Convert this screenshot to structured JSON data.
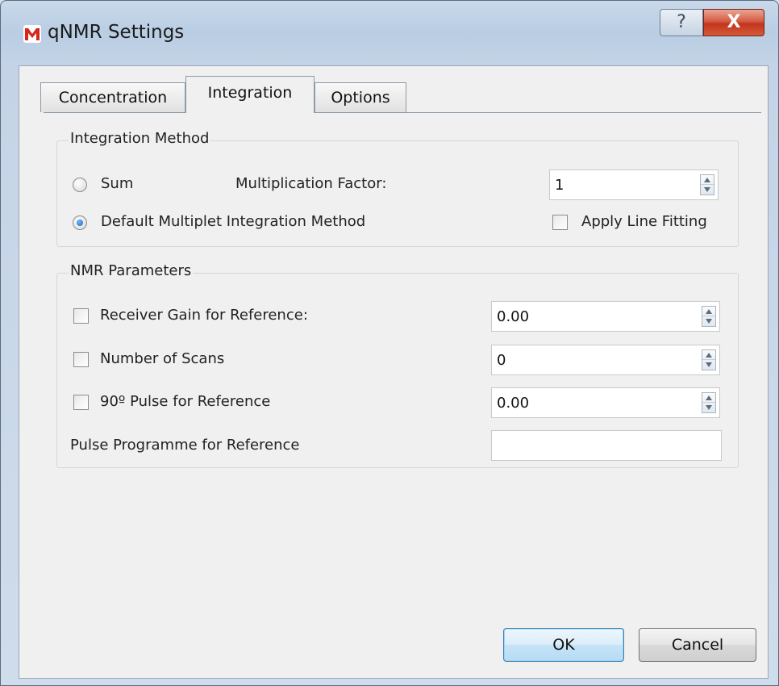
{
  "window": {
    "title": "qNMR Settings",
    "help_label": "?",
    "close_label": "X"
  },
  "tabs": [
    {
      "label": "Concentration",
      "active": false
    },
    {
      "label": "Integration",
      "active": true
    },
    {
      "label": "Options",
      "active": false
    }
  ],
  "integration_method": {
    "title": "Integration Method",
    "sum_label": "Sum",
    "sum_selected": false,
    "multiplication_factor_label": "Multiplication Factor:",
    "multiplication_factor_value": "1",
    "default_label": "Default Multiplet Integration Method",
    "default_selected": true,
    "apply_line_fitting_label": "Apply Line Fitting",
    "apply_line_fitting_checked": false
  },
  "nmr_parameters": {
    "title": "NMR Parameters",
    "receiver_gain_label": "Receiver Gain for Reference:",
    "receiver_gain_checked": false,
    "receiver_gain_value": "0.00",
    "num_scans_label": "Number of Scans",
    "num_scans_checked": false,
    "num_scans_value": "0",
    "pulse_label": "90º Pulse for Reference",
    "pulse_checked": false,
    "pulse_value": "0.00",
    "pulse_programme_label": "Pulse Programme for Reference",
    "pulse_programme_value": ""
  },
  "buttons": {
    "ok": "OK",
    "cancel": "Cancel"
  },
  "colors": {
    "close_button": "#c2351c",
    "title_bar": "#b9cde3",
    "dialog_bg": "#f0f0f0",
    "radio_selected": "#1e62c5"
  }
}
